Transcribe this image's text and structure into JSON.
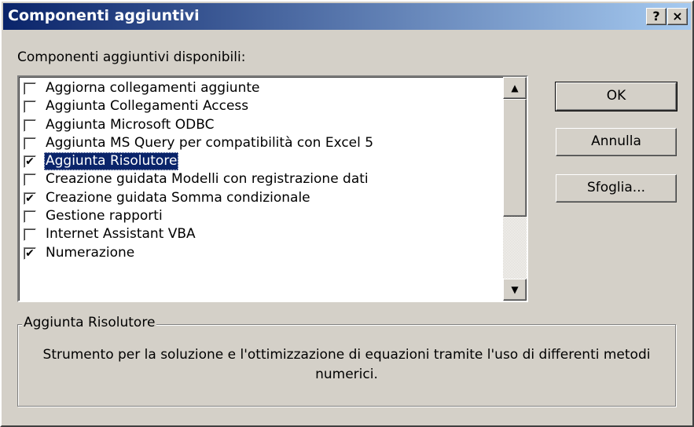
{
  "window": {
    "title": "Componenti aggiuntivi",
    "help_label": "?",
    "close_label": "×"
  },
  "list": {
    "label": "Componenti aggiuntivi disponibili:",
    "items": [
      {
        "label": "Aggiorna collegamenti aggiunte",
        "checked": false,
        "selected": false
      },
      {
        "label": "Aggiunta Collegamenti Access",
        "checked": false,
        "selected": false
      },
      {
        "label": "Aggiunta Microsoft ODBC",
        "checked": false,
        "selected": false
      },
      {
        "label": "Aggiunta MS Query per compatibilità con Excel 5",
        "checked": false,
        "selected": false
      },
      {
        "label": "Aggiunta Risolutore",
        "checked": true,
        "selected": true
      },
      {
        "label": "Creazione guidata Modelli con registrazione dati",
        "checked": false,
        "selected": false
      },
      {
        "label": "Creazione guidata Somma condizionale",
        "checked": true,
        "selected": false
      },
      {
        "label": "Gestione rapporti",
        "checked": false,
        "selected": false
      },
      {
        "label": "Internet Assistant VBA",
        "checked": false,
        "selected": false
      },
      {
        "label": "Numerazione",
        "checked": true,
        "selected": false
      }
    ]
  },
  "buttons": {
    "ok": "OK",
    "annulla": "Annulla",
    "sfoglia": "Sfoglia..."
  },
  "description": {
    "title": "Aggiunta Risolutore",
    "text": "Strumento per la soluzione e l'ottimizzazione di equazioni tramite l'uso di differenti metodi numerici."
  },
  "colors": {
    "titlebar": "#0a246a",
    "selection": "#0a246a",
    "face": "#d4d0c8"
  }
}
